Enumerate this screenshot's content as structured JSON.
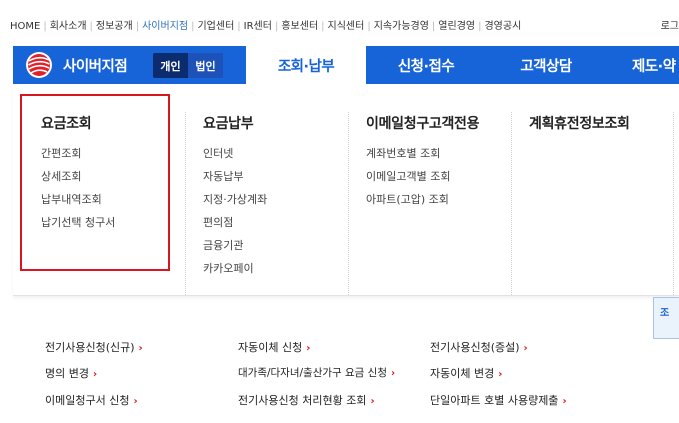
{
  "top_links": [
    {
      "label": "HOME",
      "active": false
    },
    {
      "label": "회사소개",
      "active": false
    },
    {
      "label": "정보공개",
      "active": false
    },
    {
      "label": "사이버지점",
      "active": true
    },
    {
      "label": "기업센터",
      "active": false
    },
    {
      "label": "IR센터",
      "active": false
    },
    {
      "label": "홍보센터",
      "active": false
    },
    {
      "label": "지식센터",
      "active": false
    },
    {
      "label": "지속가능경영",
      "active": false
    },
    {
      "label": "열린경영",
      "active": false
    },
    {
      "label": "경영공시",
      "active": false
    }
  ],
  "top_login": "로그",
  "brand": {
    "title": "사이버지점"
  },
  "segment": {
    "personal": "개인",
    "corporate": "법인"
  },
  "gnb_tabs": [
    {
      "label": "조회·납부",
      "active": true
    },
    {
      "label": "신청·접수",
      "active": false
    },
    {
      "label": "고객상담",
      "active": false
    },
    {
      "label": "제도·약",
      "active": false
    }
  ],
  "mega_menu": [
    {
      "title": "요금조회",
      "items": [
        "간편조회",
        "상세조회",
        "납부내역조회",
        "납기선택 청구서"
      ]
    },
    {
      "title": "요금납부",
      "items": [
        "인터넷",
        "자동납부",
        "지정·가상계좌",
        "편의점",
        "금융기관",
        "카카오페이"
      ]
    },
    {
      "title": "이메일청구고객전용",
      "items": [
        "계좌번호별 조회",
        "이메일고객별 조회",
        "아파트(고압) 조회"
      ]
    },
    {
      "title": "계획휴전정보조회",
      "items": []
    }
  ],
  "side_box": {
    "label": "조"
  },
  "quick_links": {
    "col1": [
      "전기사용신청(신규)",
      "명의 변경",
      "이메일청구서 신청"
    ],
    "col2": [
      "자동이체 신청",
      "대가족/다자녀/출산가구 요금 신청",
      "전기사용신청 처리현황 조회"
    ],
    "col3": [
      "전기사용신청(증설)",
      "자동이체 변경",
      "단일아파트 호별 사용량제출"
    ]
  },
  "colors": {
    "brand_blue": "#1763d8",
    "highlight_red": "#d8161d",
    "arrow_red": "#d8161d"
  },
  "icons": {
    "logo": "kepco-logo-icon",
    "arrow": "chevron-right-icon"
  }
}
